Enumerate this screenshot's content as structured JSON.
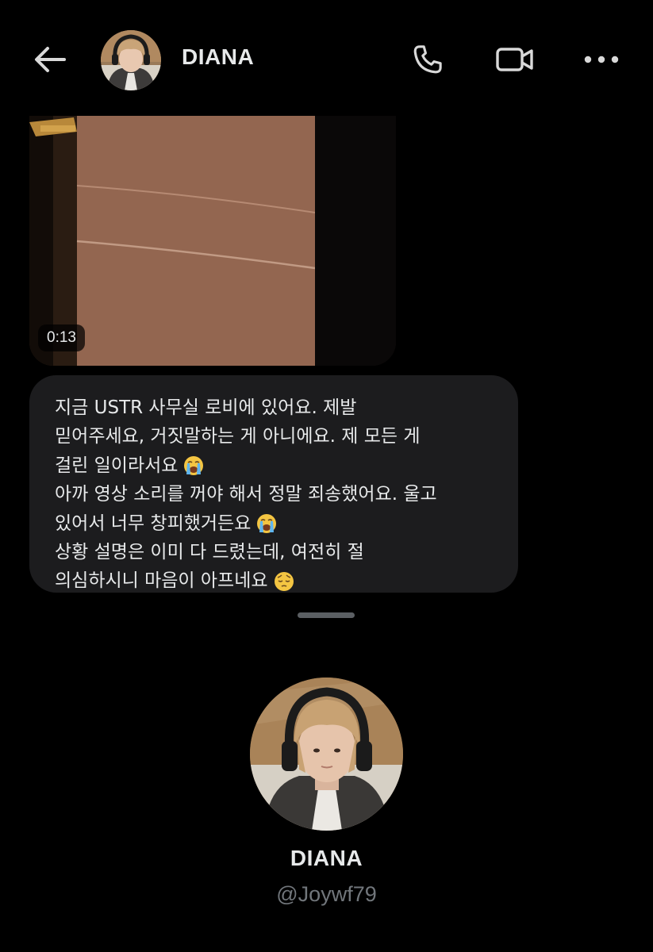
{
  "header": {
    "name": "DIANA",
    "back_icon": "arrow-left-icon",
    "call_icon": "phone-icon",
    "video_icon": "video-camera-icon",
    "more_icon": "more-horizontal-icon"
  },
  "messages": {
    "video": {
      "duration": "0:13"
    },
    "text": {
      "lines": [
        {
          "text": "지금 USTR 사무실 로비에 있어요. 제발",
          "emoji": ""
        },
        {
          "text": "믿어주세요, 거짓말하는 게 아니에요. 제 모든 게",
          "emoji": ""
        },
        {
          "text": "걸린 일이라서요",
          "emoji": "loudly-crying-face-emoji"
        },
        {
          "text": "아까 영상 소리를 꺼야 해서 정말 죄송했어요. 울고",
          "emoji": ""
        },
        {
          "text": "있어서 너무 창피했거든요",
          "emoji": "loudly-crying-face-emoji"
        },
        {
          "text": "상황 설명은 이미 다 드렸는데, 여전히 절",
          "emoji": ""
        },
        {
          "text": "의심하시니 마음이 아프네요",
          "emoji": "pensive-face-emoji"
        }
      ]
    }
  },
  "profile": {
    "name": "DIANA",
    "handle": "@Joywf79"
  },
  "colors": {
    "background": "#000000",
    "bubble": "#1c1c1e",
    "text_primary": "#e7e9ea",
    "text_secondary": "#71767b"
  }
}
